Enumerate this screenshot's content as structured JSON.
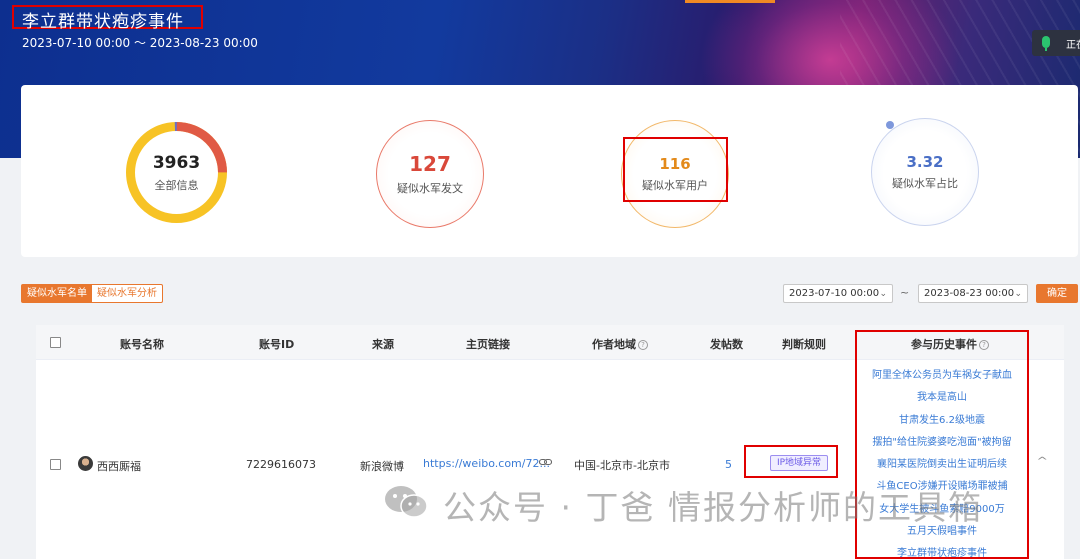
{
  "header": {
    "title": "李立群带状疱疹事件",
    "date_range": "2023-07-10 00:00 ～ 2023-08-23 00:00",
    "recording_label": "正在"
  },
  "stats": [
    {
      "value": "3963",
      "label": "全部信息"
    },
    {
      "value": "127",
      "label": "疑似水军发文"
    },
    {
      "value": "116",
      "label": "疑似水军用户"
    },
    {
      "value": "3.32",
      "label": "疑似水军占比"
    }
  ],
  "tabs": [
    {
      "label": "疑似水军名单",
      "active": true
    },
    {
      "label": "疑似水军分析",
      "active": false
    }
  ],
  "filter": {
    "start_date": "2023-07-10 00:00",
    "end_date": "2023-08-23 00:00",
    "separator": "~",
    "confirm_label": "确定"
  },
  "table": {
    "columns": [
      "账号名称",
      "账号ID",
      "来源",
      "主页链接",
      "作者地域",
      "发帖数",
      "判断规则",
      "参与历史事件"
    ],
    "row": {
      "name": "西西厮福",
      "id": "7229616073",
      "source": "新浪微博",
      "link": "https://weibo.com/72...",
      "region": "中国-北京市-北京市",
      "posts": "5",
      "rule": "IP地域异常",
      "history": [
        "阿里全体公务员为车祸女子献血",
        "我本是高山",
        "甘肃发生6.2级地震",
        "摆拍\"给住院婆婆吃泡面\"被拘留",
        "襄阳某医院倒卖出生证明后续",
        "斗鱼CEO涉嫌开设赌场罪被捕",
        "女大学生被斗鱼索赔9000万",
        "五月天假唱事件",
        "李立群带状疱疹事件"
      ]
    }
  },
  "watermark": {
    "text": "公众号 · 丁爸 情报分析师的工具箱"
  },
  "colors": {
    "accent": "#e8772e",
    "ring_yellow": "#f7c325",
    "ring_red": "#e05a45",
    "link": "#3a7bd5",
    "highlight_box": "#e00000"
  }
}
